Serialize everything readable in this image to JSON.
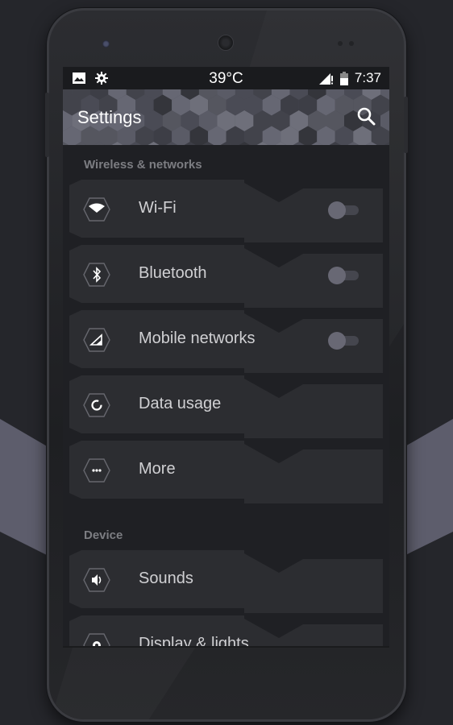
{
  "statusbar": {
    "left_icons": [
      "image-icon",
      "gear-icon"
    ],
    "temperature": "39°C",
    "right_icons": [
      "signal-icon",
      "battery-icon"
    ],
    "time": "7:37"
  },
  "toolbar": {
    "title": "Settings",
    "search_icon": "search-icon"
  },
  "sections": [
    {
      "label": "Wireless & networks",
      "items": [
        {
          "label": "Wi-Fi",
          "icon": "wifi-icon",
          "toggle": false
        },
        {
          "label": "Bluetooth",
          "icon": "bluetooth-icon",
          "toggle": false
        },
        {
          "label": "Mobile networks",
          "icon": "mobile-signal-icon",
          "toggle": false
        },
        {
          "label": "Data usage",
          "icon": "data-usage-icon"
        },
        {
          "label": "More",
          "icon": "more-icon"
        }
      ]
    },
    {
      "label": "Device",
      "items": [
        {
          "label": "Sounds",
          "icon": "volume-icon"
        },
        {
          "label": "Display & lights",
          "icon": "brightness-icon"
        }
      ]
    }
  ],
  "colors": {
    "background": "#25262b",
    "band": "#5d5d6c",
    "screen_bg": "#1f2024",
    "row_bg": "#2c2d31",
    "toggle_thumb": "#686874",
    "toggle_track": "#45464e",
    "section_label": "#7c7d82"
  }
}
